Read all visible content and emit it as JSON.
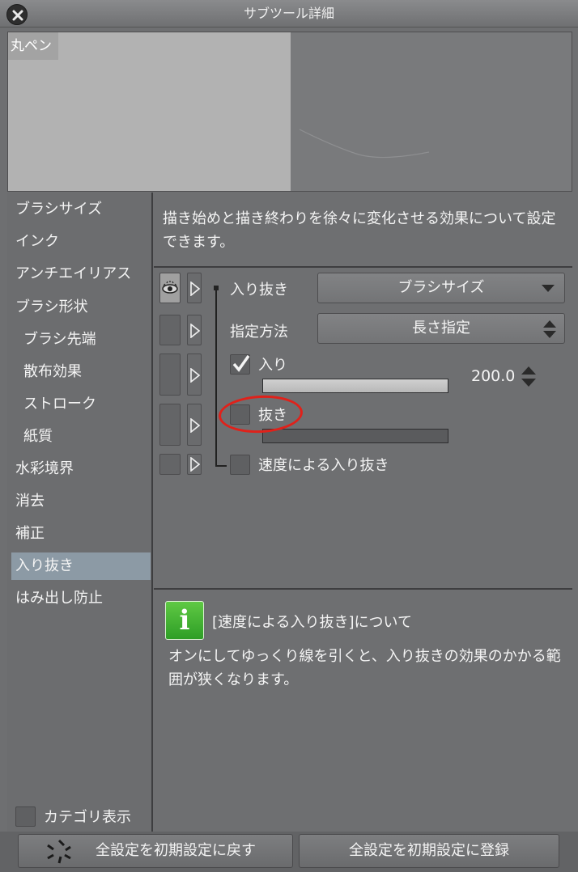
{
  "window": {
    "title": "サブツール詳細"
  },
  "preview": {
    "label": "丸ペン"
  },
  "sidebar": {
    "items": [
      {
        "label": "ブラシサイズ"
      },
      {
        "label": "インク"
      },
      {
        "label": "アンチエイリアス"
      },
      {
        "label": "ブラシ形状"
      },
      {
        "label": "ブラシ先端"
      },
      {
        "label": "散布効果"
      },
      {
        "label": "ストローク"
      },
      {
        "label": "紙質"
      },
      {
        "label": "水彩境界"
      },
      {
        "label": "消去"
      },
      {
        "label": "補正"
      },
      {
        "label": "入り抜き"
      },
      {
        "label": "はみ出し防止"
      }
    ],
    "selected_label": "入り抜き",
    "category_toggle_label": "カテゴリ表示"
  },
  "description": "描き始めと描き終わりを徐々に変化させる効果について設定できます。",
  "settings": {
    "taper_label": "入り抜き",
    "taper_target": "ブラシサイズ",
    "method_label": "指定方法",
    "method_value": "長さ指定",
    "start_label": "入り",
    "start_checked": true,
    "start_value": "200.0",
    "end_label": "抜き",
    "end_checked": false,
    "speed_label": "速度による入り抜き",
    "speed_checked": false
  },
  "info": {
    "icon_letter": "i",
    "title": "[速度による入り抜き]について",
    "body": "オンにしてゆっくり線を引くと、入り抜きの効果のかかる範囲が狭くなります。"
  },
  "footer": {
    "reset_label": "全設定を初期設定に戻す",
    "register_label": "全設定を初期設定に登録"
  },
  "colors": {
    "panel": "#6e6f71",
    "selected": "#8c9aa5",
    "highlight": "#e0211a",
    "info_green": "#3fb32f"
  }
}
